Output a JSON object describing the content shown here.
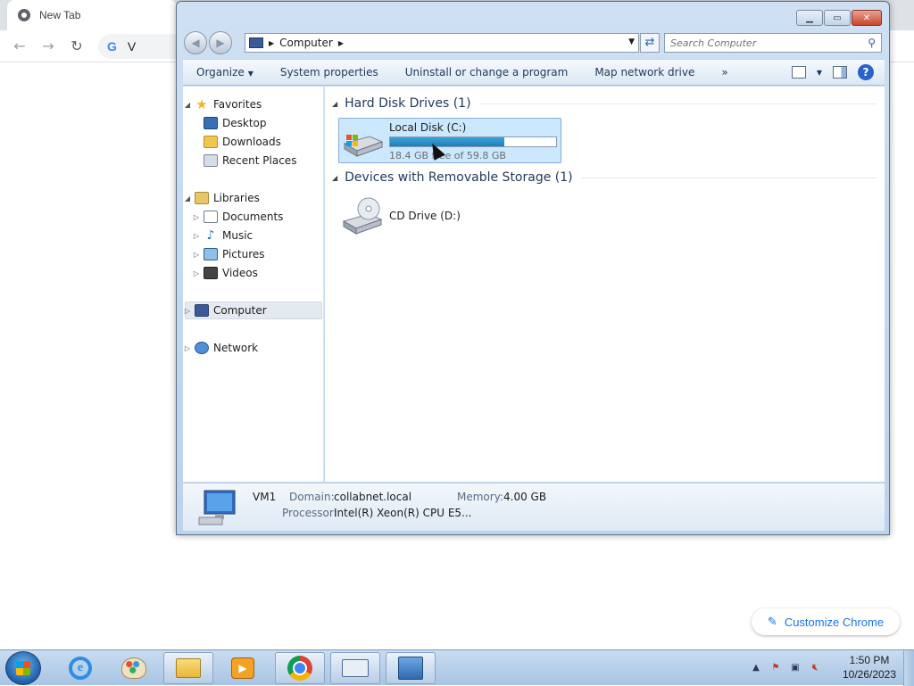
{
  "chrome": {
    "tab_title": "New Tab",
    "omnibox_text": "V",
    "customize_label": "Customize Chrome"
  },
  "explorer": {
    "breadcrumb": [
      "Computer"
    ],
    "search_placeholder": "Search Computer",
    "commands": {
      "organize": "Organize",
      "system_properties": "System properties",
      "uninstall": "Uninstall or change a program",
      "map_drive": "Map network drive",
      "more": "»"
    },
    "nav_pane": {
      "favorites": "Favorites",
      "desktop": "Desktop",
      "downloads": "Downloads",
      "recent_places": "Recent Places",
      "libraries": "Libraries",
      "documents": "Documents",
      "music": "Music",
      "pictures": "Pictures",
      "videos": "Videos",
      "computer": "Computer",
      "network": "Network"
    },
    "groups": {
      "hdd_header": "Hard Disk Drives (1)",
      "removable_header": "Devices with Removable Storage (1)"
    },
    "local_disk": {
      "name": "Local Disk (C:)",
      "free_text": "18.4 GB free of 59.8 GB",
      "used_fraction": 0.69
    },
    "cd_drive": {
      "name": "CD Drive (D:)"
    },
    "details": {
      "computer_name": "VM1",
      "domain_label": "Domain:",
      "domain_value": "collabnet.local",
      "memory_label": "Memory:",
      "memory_value": "4.00 GB",
      "processor_label": "Processor:",
      "processor_value": "Intel(R) Xeon(R) CPU E5..."
    }
  },
  "taskbar": {
    "time": "1:50 PM",
    "date": "10/26/2023",
    "apps": [
      "internet-explorer-icon",
      "paint-icon",
      "windows-explorer-icon",
      "media-player-icon",
      "chrome-icon",
      "on-screen-keyboard-icon",
      "network-tool-icon"
    ]
  }
}
